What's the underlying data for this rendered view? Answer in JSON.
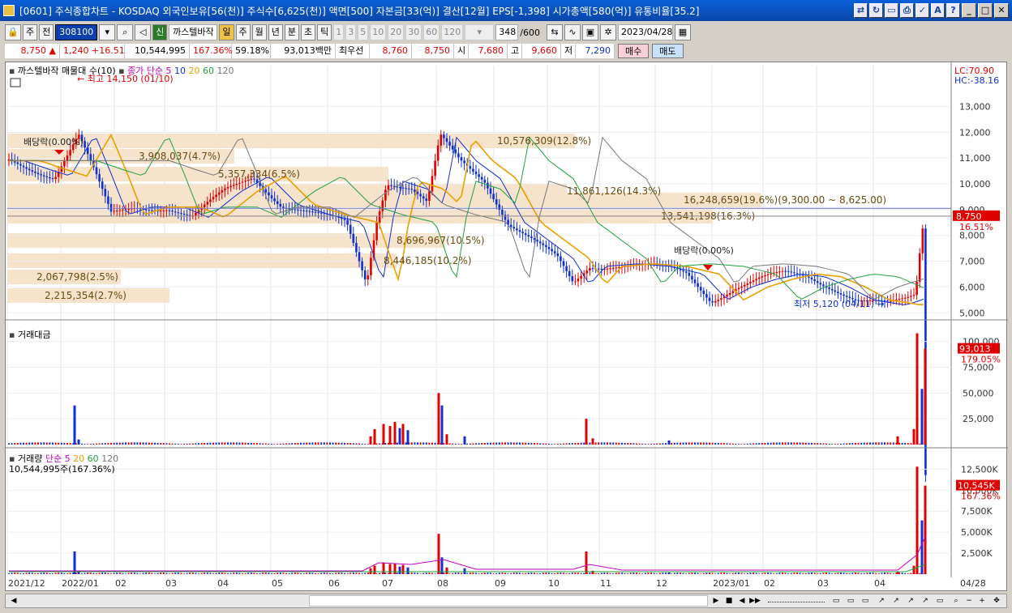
{
  "window": {
    "title": "[0601] 주식종합차트 - KOSDAQ 외국인보유[56(천)] 주식수[6,625(천)] 액면[500] 자본금[33(억)] 결산[12월] EPS[-1,398] 시가총액[580(억)] 유통비율[35.2]"
  },
  "toolbar": {
    "type": "주",
    "prev": "전",
    "code": "308100",
    "name_badge": "신",
    "name": "까스텔바작",
    "periods": [
      "일",
      "주",
      "월",
      "년",
      "분",
      "초",
      "틱"
    ],
    "nums": [
      "1",
      "3",
      "5",
      "10",
      "20",
      "30",
      "60",
      "120"
    ],
    "count": "348",
    "total": "/600",
    "date": "2023/04/28"
  },
  "quote": {
    "price": "8,750",
    "arrow": "▲",
    "change": "1,240",
    "pct": "+16.51%",
    "volume": "10,544,995",
    "vol_ratio": "167.36%",
    "turnover": "59.18%",
    "amount": "93,013백만",
    "label_best": "최우선",
    "ask": "8,760",
    "bid": "8,750",
    "open_l": "시",
    "open": "7,680",
    "high_l": "고",
    "high": "9,660",
    "low_l": "저",
    "low": "7,290",
    "buy": "매수",
    "sell": "매도"
  },
  "price_panel": {
    "title": "까스텔바작 매물대 수(10)",
    "ma_label": "종가 단순",
    "ma": [
      "5",
      "10",
      "20",
      "60",
      "120"
    ],
    "lc": "LC:70.90",
    "hc": "HC:-38.16",
    "high_note": "최고 14,150 (01/10)",
    "low_note": "최저 5,120 (04/11)",
    "div1": "배당락(0.00%)",
    "div2": "배당락(0.00%)",
    "cur_price": "8,750",
    "cur_pct": "16.51%",
    "profile": [
      "16,248,659(19.6%)(9,300.00 ~ 8,625.00)",
      "13,541,198(16.3%)",
      "11,861,126(14.3%)",
      "10,576,309(12.8%)",
      "8,696,967(10.5%)",
      "8,446,185(10.2%)",
      "5,357,334(6.5%)",
      "3,908,037(4.7%)",
      "2,215,354(2.7%)",
      "2,067,798(2.5%)"
    ],
    "yticks": [
      "13,000",
      "12,000",
      "11,000",
      "10,000",
      "9,000",
      "8,000",
      "7,000",
      "6,000",
      "5,000"
    ]
  },
  "amount_panel": {
    "title": "거래대금",
    "cur": "93,013",
    "pct": "179.05%",
    "yticks": [
      "100,000",
      "75,000",
      "50,000",
      "25,000"
    ]
  },
  "volume_panel": {
    "title": "거래량",
    "ma_label": "단순",
    "ma": [
      "5",
      "20",
      "60",
      "120"
    ],
    "summary": "10,544,995주(167.36%)",
    "cur": "10,545K",
    "pct": "167.36%",
    "yticks": [
      "12,500K",
      "10,000K",
      "7,500K",
      "5,000K",
      "2,500K"
    ]
  },
  "xaxis": [
    "2021/12",
    "2022/01",
    "02",
    "03",
    "04",
    "05",
    "06",
    "07",
    "08",
    "09",
    "10",
    "11",
    "12",
    "2023/01",
    "02",
    "03",
    "04",
    "04/28"
  ],
  "chart_data": {
    "type": "candlestick",
    "ylim": [
      4600,
      13800
    ],
    "last_close": 8750,
    "high": 14150,
    "low": 5120
  }
}
